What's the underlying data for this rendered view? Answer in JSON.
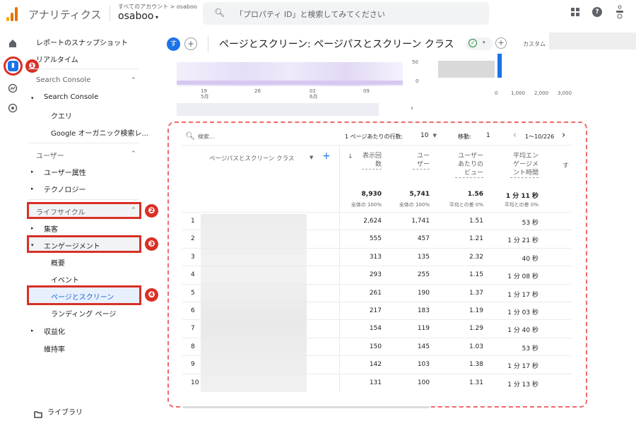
{
  "header": {
    "app_name": "アナリティクス",
    "breadcrumb": "すべてのアカウント > osaboo",
    "account": "osaboo",
    "search_placeholder": "「プロパティ ID」と検索してみてください"
  },
  "sidebar": {
    "items": [
      {
        "label": "レポートのスナップショット"
      },
      {
        "label": "リアルタイム"
      },
      {
        "label": "Search Console"
      },
      {
        "label": "Search Console"
      },
      {
        "label": "クエリ"
      },
      {
        "label": "Google オーガニック検索レ..."
      },
      {
        "label": "ユーザー"
      },
      {
        "label": "ユーザー属性"
      },
      {
        "label": "テクノロジー"
      },
      {
        "label": "ライフサイクル"
      },
      {
        "label": "集客"
      },
      {
        "label": "エンゲージメント"
      },
      {
        "label": "概要"
      },
      {
        "label": "イベント"
      },
      {
        "label": "ページとスクリーン"
      },
      {
        "label": "ランディング ページ"
      },
      {
        "label": "収益化"
      },
      {
        "label": "維持率"
      }
    ],
    "library": "ライブラリ"
  },
  "annotations": [
    "❶",
    "❷",
    "❸",
    "❹"
  ],
  "topbar": {
    "avatar": "す",
    "title": "ページとスクリーン: ページパスとスクリーン クラス",
    "custom": "カスタム"
  },
  "chart": {
    "x_ticks": [
      "19\n5月",
      "26",
      "02\n6月",
      "09"
    ],
    "y_ticks": [
      "50",
      "0"
    ],
    "bar_ticks": [
      "0",
      "1,000",
      "2,000",
      "3,000"
    ]
  },
  "table": {
    "search_placeholder": "検索...",
    "rows_per_page_label": "1 ページあたりの行数:",
    "rows_per_page": "10",
    "goto_label": "移動:",
    "goto_value": "1",
    "pagination": "1〜10/226",
    "dimension_header": "ページパスとスクリーン クラス",
    "columns": [
      "表示回数",
      "ユーザー",
      "ユーザーあたりのビュー",
      "平均エンゲージメント時間",
      "す"
    ],
    "totals": [
      "8,930",
      "5,741",
      "1.56",
      "1 分 11 秒"
    ],
    "totals_sub": [
      "全体の 100%",
      "全体の 100%",
      "平均との差 0%",
      "平均との差 0%"
    ],
    "rows": [
      {
        "n": "1",
        "views": "2,624",
        "users": "1,741",
        "vpu": "1.51",
        "time": "53 秒"
      },
      {
        "n": "2",
        "views": "555",
        "users": "457",
        "vpu": "1.21",
        "time": "1 分 21 秒"
      },
      {
        "n": "3",
        "views": "313",
        "users": "135",
        "vpu": "2.32",
        "time": "40 秒"
      },
      {
        "n": "4",
        "views": "293",
        "users": "255",
        "vpu": "1.15",
        "time": "1 分 08 秒"
      },
      {
        "n": "5",
        "views": "261",
        "users": "190",
        "vpu": "1.37",
        "time": "1 分 17 秒"
      },
      {
        "n": "6",
        "views": "217",
        "users": "183",
        "vpu": "1.19",
        "time": "1 分 03 秒"
      },
      {
        "n": "7",
        "views": "154",
        "users": "119",
        "vpu": "1.29",
        "time": "1 分 40 秒"
      },
      {
        "n": "8",
        "views": "150",
        "users": "145",
        "vpu": "1.03",
        "time": "53 秒"
      },
      {
        "n": "9",
        "views": "142",
        "users": "103",
        "vpu": "1.38",
        "time": "1 分 17 秒"
      },
      {
        "n": "10",
        "views": "131",
        "users": "100",
        "vpu": "1.31",
        "time": "1 分 13 秒"
      }
    ]
  },
  "colors": {
    "accent": "#1a73e8",
    "highlight": "#d93025",
    "dashed": "#ee6b6b"
  }
}
